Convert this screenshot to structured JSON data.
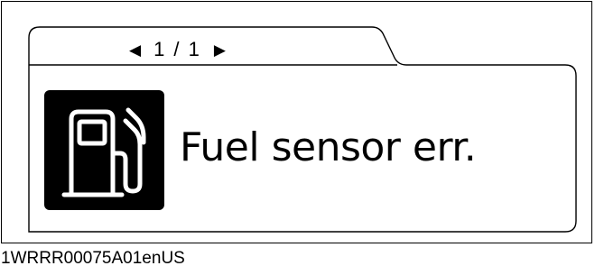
{
  "pager": {
    "prev_icon": "left-triangle-icon",
    "next_icon": "right-triangle-icon",
    "prev_glyph": "◀",
    "next_glyph": "▶",
    "page_text": "1 / 1"
  },
  "warning": {
    "icon": "fuel-pump-icon",
    "message": "Fuel sensor err."
  },
  "footer": {
    "code": "1WRRR00075A01enUS"
  },
  "colors": {
    "foreground": "#000000",
    "background": "#ffffff"
  }
}
